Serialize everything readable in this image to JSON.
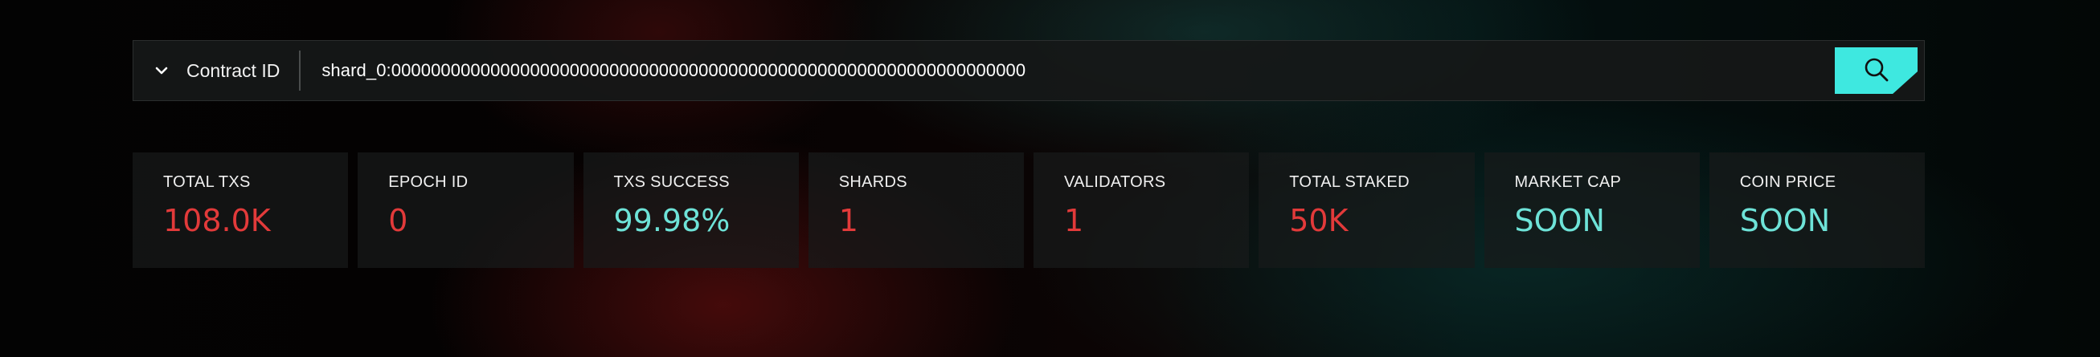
{
  "search": {
    "type_label": "Contract ID",
    "value": "shard_0:0000000000000000000000000000000000000000000000000000000000000000",
    "icon": "search-icon",
    "accent": "#3ee8e0"
  },
  "stats": [
    {
      "label": "TOTAL TXS",
      "value": "108.0K",
      "color": "red"
    },
    {
      "label": "EPOCH ID",
      "value": "0",
      "color": "red"
    },
    {
      "label": "TXS SUCCESS",
      "value": "99.98%",
      "color": "teal"
    },
    {
      "label": "SHARDS",
      "value": "1",
      "color": "red"
    },
    {
      "label": "VALIDATORS",
      "value": "1",
      "color": "red"
    },
    {
      "label": "TOTAL STAKED",
      "value": "50K",
      "color": "red"
    },
    {
      "label": "MARKET CAP",
      "value": "SOON",
      "color": "teal"
    },
    {
      "label": "COIN PRICE",
      "value": "SOON",
      "color": "teal"
    }
  ],
  "colors": {
    "red": "#e23a3a",
    "teal": "#6ee3d8",
    "background": "#040404"
  }
}
